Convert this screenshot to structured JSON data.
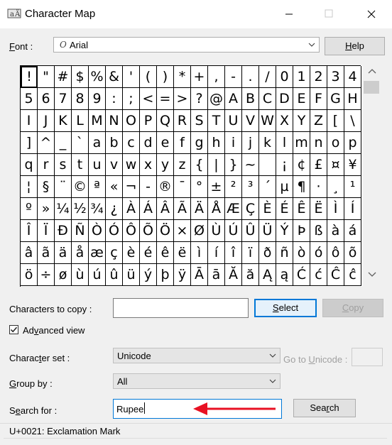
{
  "window": {
    "title": "Character Map"
  },
  "font": {
    "label": "Font :",
    "value": "Arial",
    "help_button": "Help"
  },
  "grid": {
    "rows": [
      [
        "!",
        "\"",
        "#",
        "$",
        "%",
        "&",
        "'",
        "(",
        ")",
        "*",
        "+",
        ",",
        "-",
        ".",
        "/",
        "0",
        "1",
        "2",
        "3",
        "4"
      ],
      [
        "5",
        "6",
        "7",
        "8",
        "9",
        ":",
        ";",
        "<",
        "=",
        ">",
        "?",
        "@",
        "A",
        "B",
        "C",
        "D",
        "E",
        "F",
        "G",
        "H"
      ],
      [
        "I",
        "J",
        "K",
        "L",
        "M",
        "N",
        "O",
        "P",
        "Q",
        "R",
        "S",
        "T",
        "U",
        "V",
        "W",
        "X",
        "Y",
        "Z",
        "[",
        "\\"
      ],
      [
        "]",
        "^",
        "_",
        "`",
        "a",
        "b",
        "c",
        "d",
        "e",
        "f",
        "g",
        "h",
        "i",
        "j",
        "k",
        "l",
        "m",
        "n",
        "o",
        "p"
      ],
      [
        "q",
        "r",
        "s",
        "t",
        "u",
        "v",
        "w",
        "x",
        "y",
        "z",
        "{",
        "|",
        "}",
        "~",
        " ",
        "¡",
        "¢",
        "£",
        "¤",
        "¥"
      ],
      [
        "¦",
        "§",
        "¨",
        "©",
        "ª",
        "«",
        "¬",
        "-",
        "®",
        "¯",
        "°",
        "±",
        "²",
        "³",
        "´",
        "µ",
        "¶",
        "·",
        "¸",
        "¹"
      ],
      [
        "º",
        "»",
        "¼",
        "½",
        "¾",
        "¿",
        "À",
        "Á",
        "Â",
        "Ã",
        "Ä",
        "Å",
        "Æ",
        "Ç",
        "È",
        "É",
        "Ê",
        "Ë",
        "Ì",
        "Í"
      ],
      [
        "Î",
        "Ï",
        "Ð",
        "Ñ",
        "Ò",
        "Ó",
        "Ô",
        "Õ",
        "Ö",
        "×",
        "Ø",
        "Ù",
        "Ú",
        "Û",
        "Ü",
        "Ý",
        "Þ",
        "ß",
        "à",
        "á"
      ],
      [
        "â",
        "ã",
        "ä",
        "å",
        "æ",
        "ç",
        "è",
        "é",
        "ê",
        "ë",
        "ì",
        "í",
        "î",
        "ï",
        "ð",
        "ñ",
        "ò",
        "ó",
        "ô",
        "õ"
      ],
      [
        "ö",
        "÷",
        "ø",
        "ù",
        "ú",
        "û",
        "ü",
        "ý",
        "þ",
        "ÿ",
        "Ā",
        "ā",
        "Ă",
        "ă",
        "Ą",
        "ą",
        "Ć",
        "ć",
        "Ĉ",
        "ĉ"
      ]
    ]
  },
  "copy": {
    "label": "Characters to copy :",
    "value": "",
    "select_button": "Select",
    "copy_button": "Copy"
  },
  "advanced": {
    "label": "Advanced view",
    "checked": true
  },
  "charset": {
    "label": "Character set :",
    "value": "Unicode",
    "goto_label": "Go to Unicode :"
  },
  "groupby": {
    "label": "Group by :",
    "value": "All"
  },
  "search": {
    "label": "Search for :",
    "value": "Rupee",
    "button": "Search"
  },
  "status": {
    "text": "U+0021: Exclamation Mark"
  },
  "colors": {
    "accent": "#0078d7",
    "arrow": "#e81123"
  }
}
